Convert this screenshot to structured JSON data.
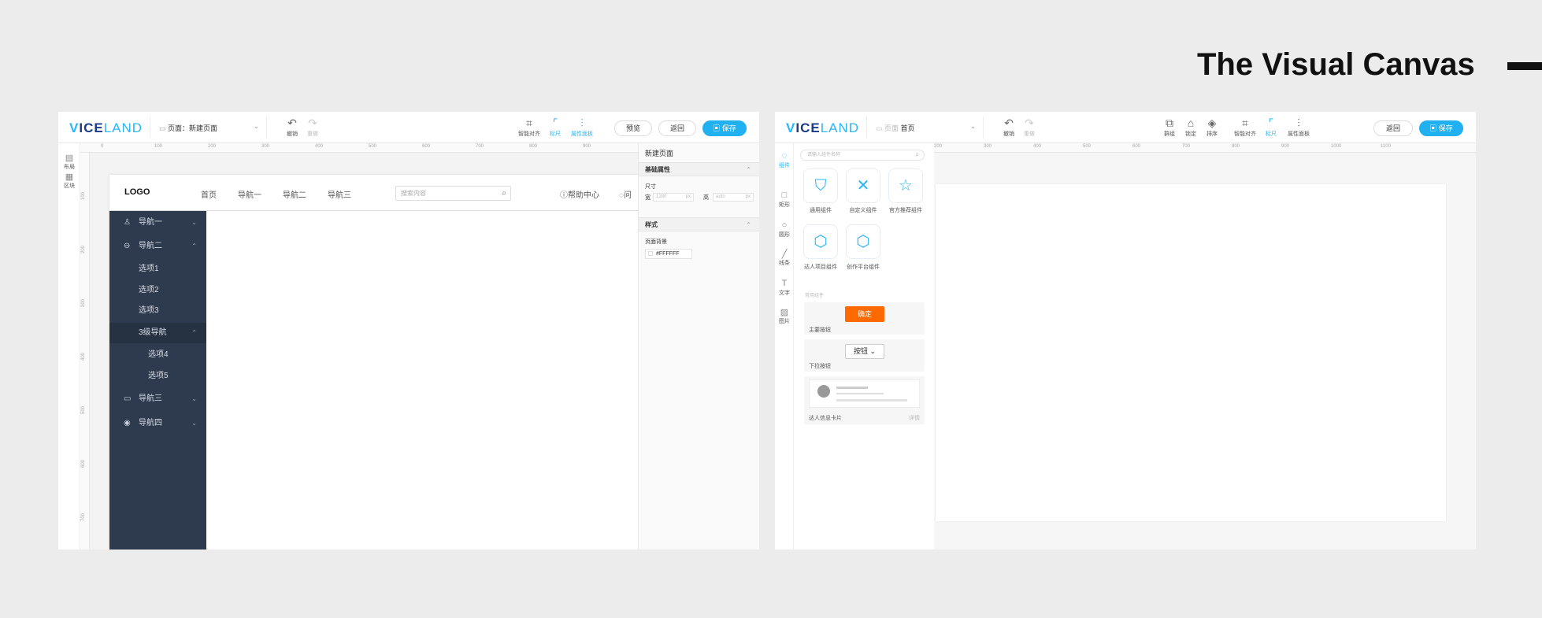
{
  "heading": "The Visual Canvas",
  "colors": {
    "accent": "#22b1f0",
    "sidebar_bg": "#2e3a4d",
    "confirm_btn": "#ff6a00"
  },
  "logo": {
    "v": "V",
    "ice": "ICE",
    "land": "LAND"
  },
  "left": {
    "page_label": "页面：新建页面",
    "tools": {
      "undo": "撤销",
      "redo": "重做",
      "align": "智能对齐",
      "ruler": "标尺",
      "props": "属性面板"
    },
    "buttons": {
      "preview": "预览",
      "back": "返回",
      "save": "保存"
    },
    "rail": {
      "layout": "布局",
      "block": "区块"
    },
    "ruler_ticks": [
      "0",
      "100",
      "200",
      "300",
      "400",
      "500",
      "600",
      "700",
      "800",
      "900"
    ],
    "vruler_ticks": [
      "100",
      "200",
      "300",
      "400",
      "500",
      "600",
      "700",
      "800"
    ],
    "site": {
      "logo": "LOGO",
      "nav": [
        "首页",
        "导航一",
        "导航二",
        "导航三"
      ],
      "search_placeholder": "搜索内容",
      "help": "帮助中心",
      "more": "问",
      "sidebar": [
        {
          "label": "导航一",
          "icon": "award-icon",
          "arrow": "⌄"
        },
        {
          "label": "导航二",
          "icon": "chat-icon",
          "arrow": "⌃"
        },
        {
          "label": "选项1"
        },
        {
          "label": "选项2"
        },
        {
          "label": "选项3"
        },
        {
          "label": "3级导航",
          "arrow": "⌃"
        },
        {
          "label": "选项4"
        },
        {
          "label": "选项5"
        },
        {
          "label": "导航三",
          "icon": "folder-icon",
          "arrow": "⌄"
        },
        {
          "label": "导航四",
          "icon": "eye-icon",
          "arrow": "⌄"
        }
      ]
    },
    "props": {
      "title": "新建页面",
      "basic": "基础属性",
      "size": "尺寸",
      "w_label": "宽",
      "w_value": "1280",
      "h_label": "高",
      "h_value": "auto",
      "unit": "px",
      "style": "样式",
      "bg_label": "页面背景",
      "bg_value": "#FFFFFF"
    }
  },
  "right": {
    "page_prefix": "页面",
    "page_value": "首页",
    "tools": {
      "undo": "撤销",
      "redo": "重做",
      "group": "群组",
      "lock": "锁定",
      "order": "排序",
      "align": "智能对齐",
      "ruler": "标尺",
      "props": "属性面板"
    },
    "buttons": {
      "back": "返回",
      "save": "保存"
    },
    "rail": {
      "component": "组件",
      "rect": "矩形",
      "circle": "圆形",
      "line": "线条",
      "text": "文字",
      "image": "图片"
    },
    "ruler_ticks": [
      "200",
      "300",
      "400",
      "500",
      "600",
      "700",
      "800",
      "900",
      "1000",
      "1100"
    ],
    "search_placeholder": "请输入组件名称",
    "categories": [
      {
        "label": "通用组件",
        "icon": "generic-component-icon"
      },
      {
        "label": "自定义组件",
        "icon": "custom-component-icon"
      },
      {
        "label": "官方推荐组件",
        "icon": "star-icon"
      },
      {
        "label": "达人项目组件",
        "icon": "talent-project-icon"
      },
      {
        "label": "创作平台组件",
        "icon": "creator-platform-icon"
      }
    ],
    "common_hint": "常用组件",
    "cards": {
      "confirm": "确定",
      "primary_label": "主要按钮",
      "dropdown": "按钮",
      "dropdown_label": "下拉按钮",
      "talent_label": "达人信息卡片",
      "talent_more": "详情"
    }
  }
}
